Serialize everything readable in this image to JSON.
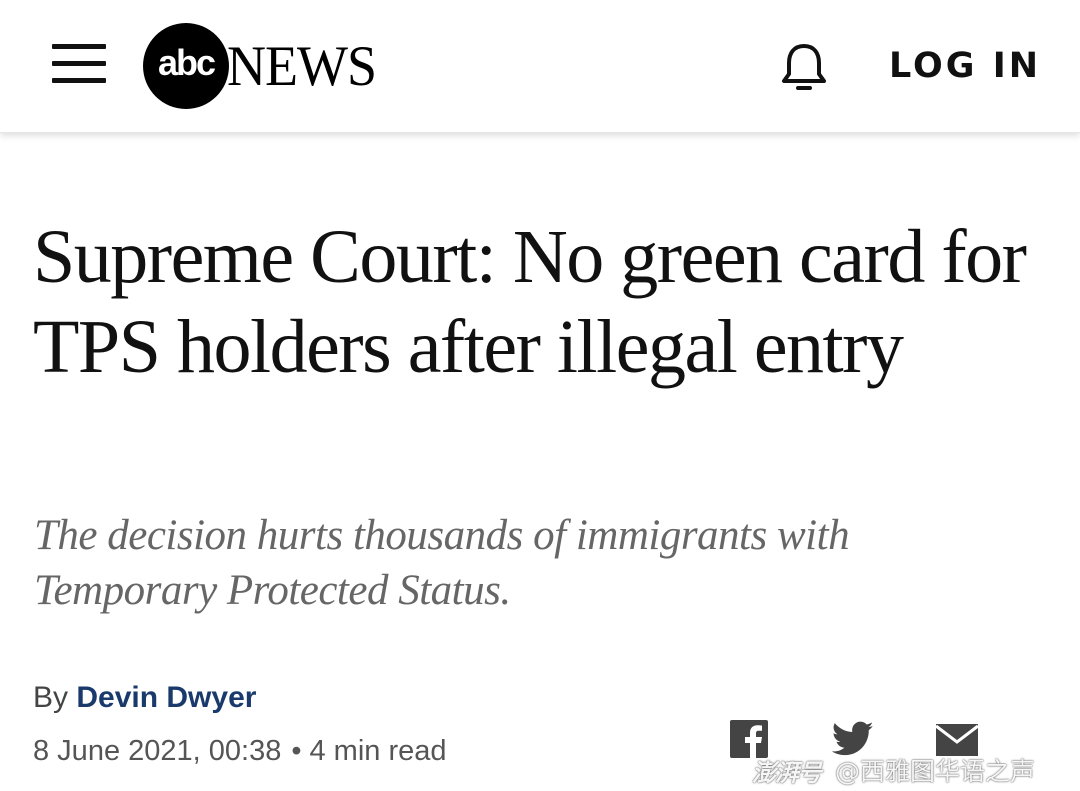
{
  "header": {
    "menu_icon": "hamburger-menu-icon",
    "logo_mark": "abc",
    "logo_word": "NEWS",
    "notification_icon": "bell-icon",
    "login_label": "LOG IN"
  },
  "article": {
    "headline": "Supreme Court: No green card for TPS holders after illegal entry",
    "subheadline": "The decision hurts thousands of immigrants with Temporary Protected Status.",
    "byline_prefix": "By",
    "author": "Devin Dwyer",
    "date": "8 June 2021, 00:38",
    "separator": "•",
    "read_time": "4 min read"
  },
  "share": {
    "icons": [
      "facebook-icon",
      "twitter-icon",
      "email-icon"
    ]
  },
  "watermark": {
    "brand": "澎湃号",
    "handle": "@西雅图华语之声"
  },
  "colors": {
    "author": "#1a3a6b",
    "subhead": "#666666",
    "icons": "#444444"
  }
}
